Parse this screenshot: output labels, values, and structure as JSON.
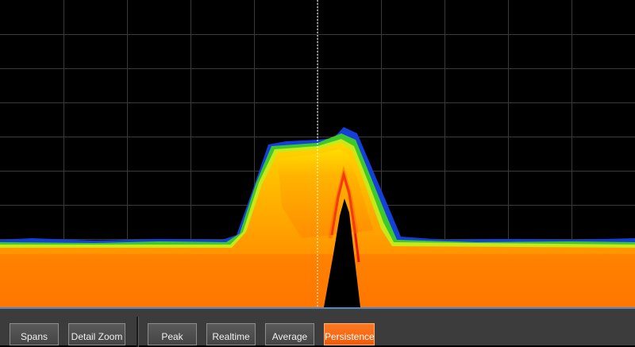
{
  "colors": {
    "background": "#000000",
    "grid": "#3a3a3a",
    "marker": "#ffffff",
    "toolbar": "#3c3c3c",
    "toolbar_accent": "#4f88c6",
    "active_button": "#f26410"
  },
  "display": {
    "mode": "persistence",
    "grid": true,
    "grid_columns": 10,
    "grid_rows": 9,
    "center_marker_fraction": 0.5
  },
  "toolbar": {
    "spans_label": "Spans",
    "detail_zoom_label": "Detail Zoom",
    "peak_label": "Peak",
    "realtime_label": "Realtime",
    "average_label": "Average",
    "persistence_label": "Persistence",
    "active": "persistence"
  }
}
